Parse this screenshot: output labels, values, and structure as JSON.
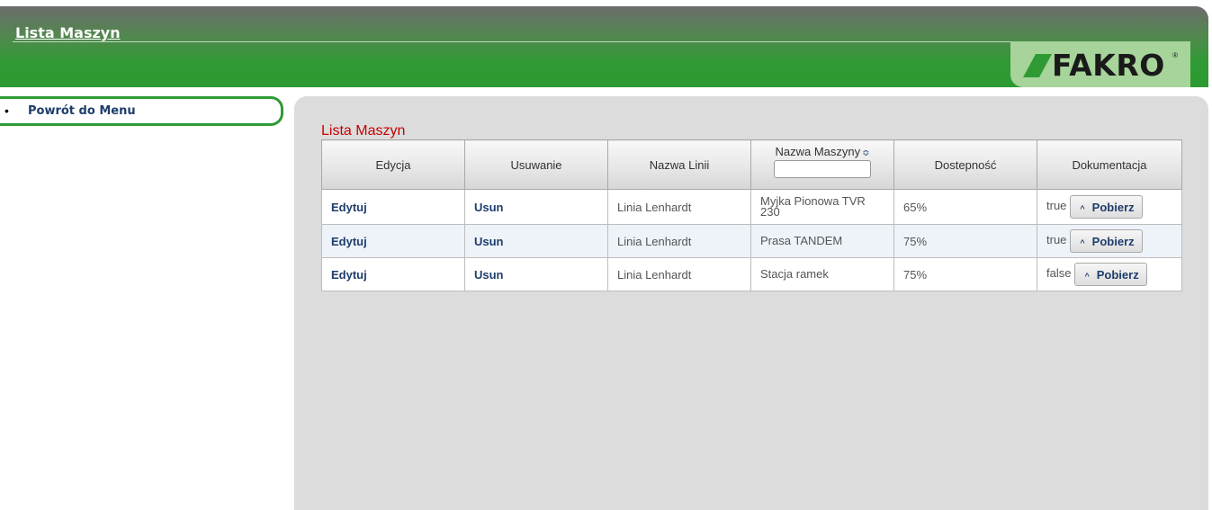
{
  "header": {
    "title": "Lista Maszyn",
    "logo_text": "FAKRO",
    "logo_reg": "®"
  },
  "nav": {
    "items": [
      {
        "label": "Powrót do Menu"
      }
    ]
  },
  "main": {
    "section_title": "Lista Maszyn"
  },
  "table": {
    "columns": [
      "Edycja",
      "Usuwanie",
      "Nazwa Linii",
      "Nazwa Maszyny",
      "Dostepność",
      "Dokumentacja"
    ],
    "sort_glyph": "≎",
    "rows": [
      {
        "edit": "Edytuj",
        "delete": "Usun",
        "line": "Linia Lenhardt",
        "machine": "Myjka Pionowa TVR 230",
        "availability": "65%",
        "doc": "true",
        "button": "Pobierz"
      },
      {
        "edit": "Edytuj",
        "delete": "Usun",
        "line": "Linia Lenhardt",
        "machine": "Prasa TANDEM",
        "availability": "75%",
        "doc": "true",
        "button": "Pobierz"
      },
      {
        "edit": "Edytuj",
        "delete": "Usun",
        "line": "Linia Lenhardt",
        "machine": "Stacja ramek",
        "availability": "75%",
        "doc": "false",
        "button": "Pobierz"
      }
    ]
  },
  "icons": {
    "sort": "sort-icon",
    "download": "chevron-up-icon"
  },
  "colors": {
    "brand_green": "#2f9a34",
    "title_red": "#c80000",
    "link_blue": "#1e3d6b",
    "panel_gray": "#dcdcdc"
  }
}
